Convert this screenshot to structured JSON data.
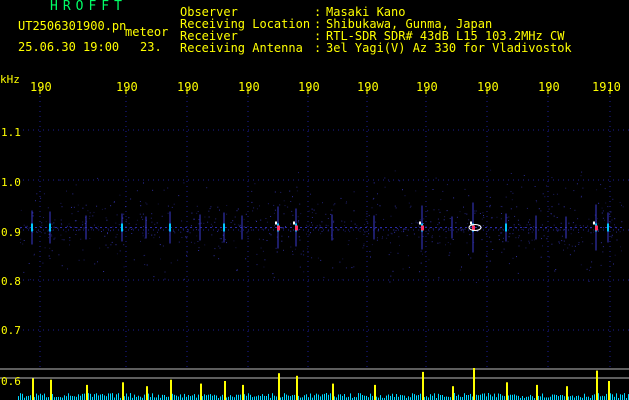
{
  "station": {
    "name": "HROFFT",
    "filename": "UT2506301900.pn",
    "mode": "meteor",
    "datetime": "25.06.30 19:00",
    "count": "23."
  },
  "info": [
    {
      "label": "Observer",
      "value": "Masaki Kano"
    },
    {
      "label": "Receiving Location",
      "value": "Shibukawa, Gunma, Japan"
    },
    {
      "label": "Receiver",
      "value": "RTL-SDR SDR# 43dB L15 103.2MHz CW"
    },
    {
      "label": "Receiving Antenna",
      "value": "3el Yagi(V) Az 330 for Vladivostok"
    }
  ],
  "axis": {
    "unit": "kHz",
    "time_ticks": [
      "190",
      "190",
      "190",
      "190",
      "190",
      "190",
      "190",
      "190",
      "190",
      "1910"
    ],
    "freq_ticks": [
      "1.1",
      "1.0",
      "0.9",
      "0.8",
      "0.7",
      "0.6"
    ]
  },
  "colors": {
    "background": "#000000",
    "text": "#ffff00",
    "title": "#00ff66",
    "grid": "#1e1e9a",
    "meter": "#ffff00",
    "meter_noise": "#00d8ff"
  },
  "chart_data": {
    "type": "heatmap",
    "xlabel": "",
    "ylabel": "kHz",
    "ylim": [
      0.6,
      1.15
    ],
    "center_freq": 0.905,
    "events": [
      {
        "t": 0.01,
        "strength": 0.6
      },
      {
        "t": 0.04,
        "strength": 0.55
      },
      {
        "t": 0.1,
        "strength": 0.35
      },
      {
        "t": 0.16,
        "strength": 0.45
      },
      {
        "t": 0.2,
        "strength": 0.3
      },
      {
        "t": 0.24,
        "strength": 0.55
      },
      {
        "t": 0.29,
        "strength": 0.4
      },
      {
        "t": 0.33,
        "strength": 0.5
      },
      {
        "t": 0.36,
        "strength": 0.35
      },
      {
        "t": 0.42,
        "strength": 0.8
      },
      {
        "t": 0.45,
        "strength": 0.7
      },
      {
        "t": 0.51,
        "strength": 0.4
      },
      {
        "t": 0.58,
        "strength": 0.35
      },
      {
        "t": 0.66,
        "strength": 0.85
      },
      {
        "t": 0.71,
        "strength": 0.3
      },
      {
        "t": 0.745,
        "strength": 1.0
      },
      {
        "t": 0.8,
        "strength": 0.45
      },
      {
        "t": 0.85,
        "strength": 0.35
      },
      {
        "t": 0.9,
        "strength": 0.3
      },
      {
        "t": 0.95,
        "strength": 0.9
      },
      {
        "t": 0.97,
        "strength": 0.5
      }
    ]
  }
}
